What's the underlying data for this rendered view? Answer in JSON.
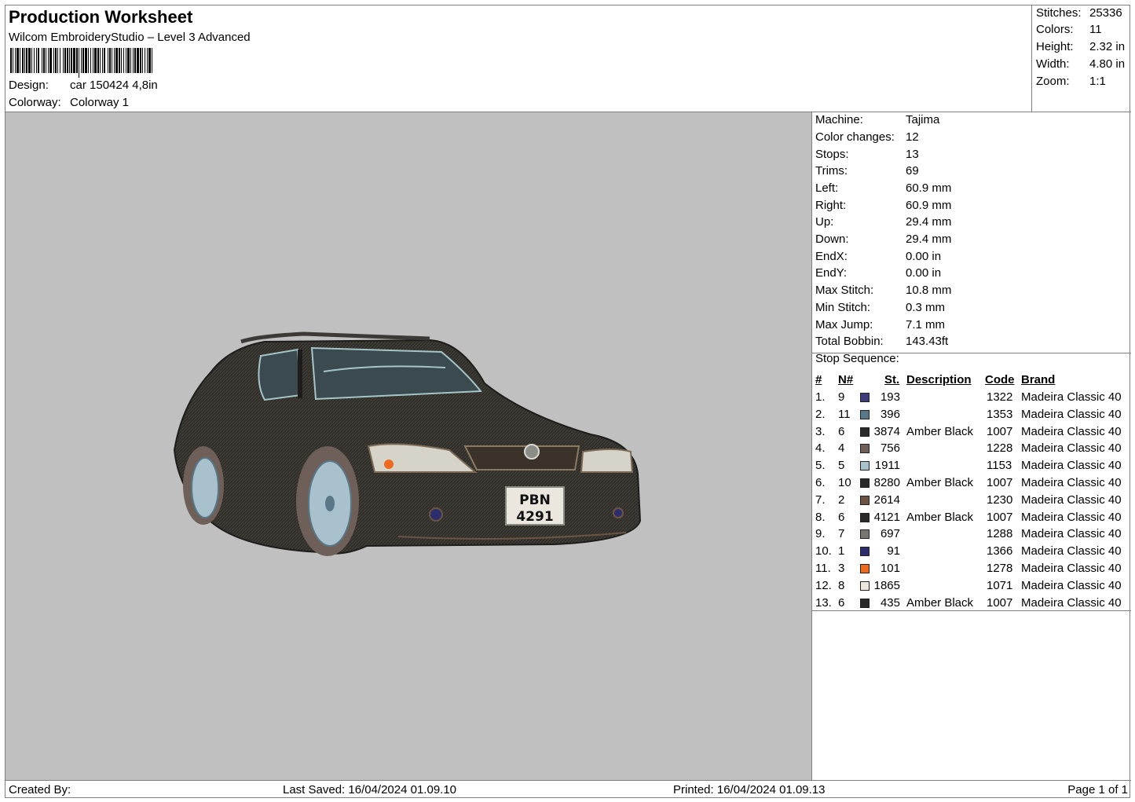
{
  "header": {
    "title": "Production Worksheet",
    "subtitle": "Wilcom EmbroideryStudio – Level 3 Advanced",
    "design_label": "Design:",
    "design_value": "car 150424 4,8in",
    "colorway_label": "Colorway:",
    "colorway_value": "Colorway 1"
  },
  "summary": [
    {
      "label": "Stitches:",
      "value": "25336"
    },
    {
      "label": "Colors:",
      "value": "11"
    },
    {
      "label": "Height:",
      "value": "2.32 in"
    },
    {
      "label": "Width:",
      "value": "4.80 in"
    },
    {
      "label": "Zoom:",
      "value": "1:1"
    }
  ],
  "machine_info": [
    {
      "label": "Machine:",
      "value": "Tajima"
    },
    {
      "label": "Color changes:",
      "value": "12"
    },
    {
      "label": "Stops:",
      "value": "13"
    },
    {
      "label": "Trims:",
      "value": "69"
    },
    {
      "label": "Left:",
      "value": "60.9 mm"
    },
    {
      "label": "Right:",
      "value": "60.9 mm"
    },
    {
      "label": "Up:",
      "value": "29.4 mm"
    },
    {
      "label": "Down:",
      "value": "29.4 mm"
    },
    {
      "label": "EndX:",
      "value": "0.00 in"
    },
    {
      "label": "EndY:",
      "value": "0.00 in"
    },
    {
      "label": "Max Stitch:",
      "value": "10.8 mm"
    },
    {
      "label": "Min Stitch:",
      "value": "0.3 mm"
    },
    {
      "label": "Max Jump:",
      "value": "7.1 mm"
    },
    {
      "label": "Total Bobbin:",
      "value": "143.43ft"
    }
  ],
  "stop_sequence": {
    "title": "Stop Sequence:",
    "columns": {
      "num": "#",
      "n": "N#",
      "st": "St.",
      "desc": "Description",
      "code": "Code",
      "brand": "Brand"
    },
    "rows": [
      {
        "num": "1.",
        "n": "9",
        "color": "#3d3b7a",
        "st": "193",
        "desc": "",
        "code": "1322",
        "brand": "Madeira Classic 40"
      },
      {
        "num": "2.",
        "n": "11",
        "color": "#587889",
        "st": "396",
        "desc": "",
        "code": "1353",
        "brand": "Madeira Classic 40"
      },
      {
        "num": "3.",
        "n": "6",
        "color": "#2a2a2a",
        "st": "3874",
        "desc": "Amber Black",
        "code": "1007",
        "brand": "Madeira Classic 40"
      },
      {
        "num": "4.",
        "n": "4",
        "color": "#6e6058",
        "st": "756",
        "desc": "",
        "code": "1228",
        "brand": "Madeira Classic 40"
      },
      {
        "num": "5.",
        "n": "5",
        "color": "#a9c1cc",
        "st": "1911",
        "desc": "",
        "code": "1153",
        "brand": "Madeira Classic 40"
      },
      {
        "num": "6.",
        "n": "10",
        "color": "#2a2a2a",
        "st": "8280",
        "desc": "Amber Black",
        "code": "1007",
        "brand": "Madeira Classic 40"
      },
      {
        "num": "7.",
        "n": "2",
        "color": "#6b5444",
        "st": "2614",
        "desc": "",
        "code": "1230",
        "brand": "Madeira Classic 40"
      },
      {
        "num": "8.",
        "n": "6",
        "color": "#2a2a2a",
        "st": "4121",
        "desc": "Amber Black",
        "code": "1007",
        "brand": "Madeira Classic 40"
      },
      {
        "num": "9.",
        "n": "7",
        "color": "#7a7672",
        "st": "697",
        "desc": "",
        "code": "1288",
        "brand": "Madeira Classic 40"
      },
      {
        "num": "10.",
        "n": "1",
        "color": "#2b2e6b",
        "st": "91",
        "desc": "",
        "code": "1366",
        "brand": "Madeira Classic 40"
      },
      {
        "num": "11.",
        "n": "3",
        "color": "#f06a1e",
        "st": "101",
        "desc": "",
        "code": "1278",
        "brand": "Madeira Classic 40"
      },
      {
        "num": "12.",
        "n": "8",
        "color": "#ebe7df",
        "st": "1865",
        "desc": "",
        "code": "1071",
        "brand": "Madeira Classic 40"
      },
      {
        "num": "13.",
        "n": "6",
        "color": "#2a2a2a",
        "st": "435",
        "desc": "Amber Black",
        "code": "1007",
        "brand": "Madeira Classic 40"
      }
    ]
  },
  "preview": {
    "plate_line1": "PBN",
    "plate_line2": "4291",
    "background": "#c0c0c0"
  },
  "footer": {
    "created_by": "Created By:",
    "last_saved": "Last Saved: 16/04/2024 01.09.10",
    "printed": "Printed: 16/04/2024 01.09.13",
    "page": "Page 1 of 1"
  }
}
